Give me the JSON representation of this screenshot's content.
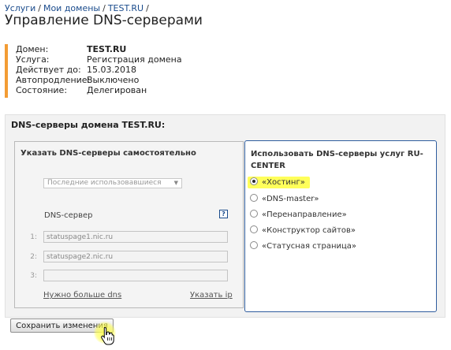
{
  "breadcrumb": {
    "items": [
      "Услуги",
      "Мои домены",
      "TEST.RU"
    ],
    "separator": "/"
  },
  "page_title": "Управление DNS-серверами",
  "info": {
    "rows": [
      {
        "label": "Домен:",
        "value": "TEST.RU"
      },
      {
        "label": "Услуга:",
        "value": "Регистрация домена"
      },
      {
        "label": "Действует до:",
        "value": "15.03.2018"
      },
      {
        "label": "Автопродление:",
        "value": "Выключено"
      },
      {
        "label": "Состояние:",
        "value": "Делегирован"
      }
    ],
    "accent_color": "#f39c34"
  },
  "panel": {
    "title": "DNS-серверы домена TEST.RU:",
    "manual": {
      "title": "Указать DNS-серверы самостоятельно",
      "select_value": "Последние использовавшиеся",
      "dns_label": "DNS-сервер",
      "help_icon": "?",
      "servers": [
        {
          "num": "1:",
          "value": "statuspage1.nic.ru"
        },
        {
          "num": "2:",
          "value": "statuspage2.nic.ru"
        },
        {
          "num": "3:",
          "value": ""
        }
      ],
      "more_link": "Нужно больше dns",
      "ip_link": "Указать ip"
    },
    "service": {
      "title": "Использовать DNS-серверы услуг RU-CENTER",
      "options": [
        {
          "label": "«Хостинг»",
          "checked": true
        },
        {
          "label": "«DNS-master»",
          "checked": false
        },
        {
          "label": "«Перенаправление»",
          "checked": false
        },
        {
          "label": "«Конструктор сайтов»",
          "checked": false
        },
        {
          "label": "«Статусная страница»",
          "checked": false
        }
      ],
      "border_color": "#2f5d9e",
      "highlight_color": "#ffff5a"
    }
  },
  "save_button": "Сохранить изменения",
  "cursor_icon": "hand-pointer-icon"
}
